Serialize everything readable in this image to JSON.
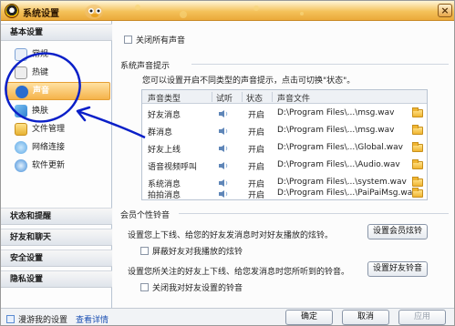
{
  "window": {
    "title": "系统设置",
    "close_glyph": "×"
  },
  "sidebar": {
    "basic_header": "基本设置",
    "items": [
      {
        "label": "常规",
        "icon": "general-icon",
        "color": "#4a86d6"
      },
      {
        "label": "热键",
        "icon": "hotkey-icon",
        "color": "#7a7a7a"
      },
      {
        "label": "声音",
        "icon": "sound-icon",
        "color": "#2a6ccf"
      },
      {
        "label": "换肤",
        "icon": "skin-icon",
        "color": "#3d9be0"
      },
      {
        "label": "文件管理",
        "icon": "folder-icon",
        "color": "#e6b233"
      },
      {
        "label": "网络连接",
        "icon": "network-icon",
        "color": "#5aa7e6"
      },
      {
        "label": "软件更新",
        "icon": "update-icon",
        "color": "#3c8ad8"
      }
    ],
    "selected_index": 2,
    "sections": [
      "状态和提醒",
      "好友和聊天",
      "安全设置",
      "隐私设置"
    ]
  },
  "content": {
    "close_all_sounds": "关闭所有声音",
    "system_sound_title": "系统声音提示",
    "system_sound_desc": "您可以设置开启不同类型的声音提示，点击可切换\"状态\"。",
    "table": {
      "headers": [
        "声音类型",
        "试听",
        "状态",
        "声音文件"
      ],
      "rows": [
        {
          "type": "好友消息",
          "status": "开启",
          "file": "D:\\Program Files\\...\\msg.wav"
        },
        {
          "type": "群消息",
          "status": "开启",
          "file": "D:\\Program Files\\...\\msg.wav"
        },
        {
          "type": "好友上线",
          "status": "开启",
          "file": "D:\\Program Files\\...\\Global.wav"
        },
        {
          "type": "语音视频呼叫",
          "status": "开启",
          "file": "D:\\Program Files\\...\\Audio.wav"
        },
        {
          "type": "系统消息",
          "status": "开启",
          "file": "D:\\Program Files\\...\\system.wav"
        },
        {
          "type": "拍拍消息",
          "status": "开启",
          "file": "D:\\Program Files\\...\\PaiPaiMsg.wav"
        }
      ]
    },
    "member_title": "会员个性铃音",
    "member_desc1": "设置您上下线、给您的好友发消息时对好友播放的炫铃。",
    "member_button": "设置会员炫铃",
    "block_friend_ring": "屏蔽好友对我播放的炫铃",
    "member_desc2": "设置您所关注的好友上下线、给您发消息时您所听到的铃音。",
    "friend_ring_button": "设置好友铃音",
    "close_friend_ring": "关闭我对好友设置的铃音"
  },
  "footer": {
    "roam_label": "漫游我的设置",
    "view_details": "查看详情",
    "ok": "确定",
    "cancel": "取消",
    "apply": "应用"
  },
  "colors": {
    "accent": "#f5b34a",
    "annotation": "#0a1fc8"
  }
}
